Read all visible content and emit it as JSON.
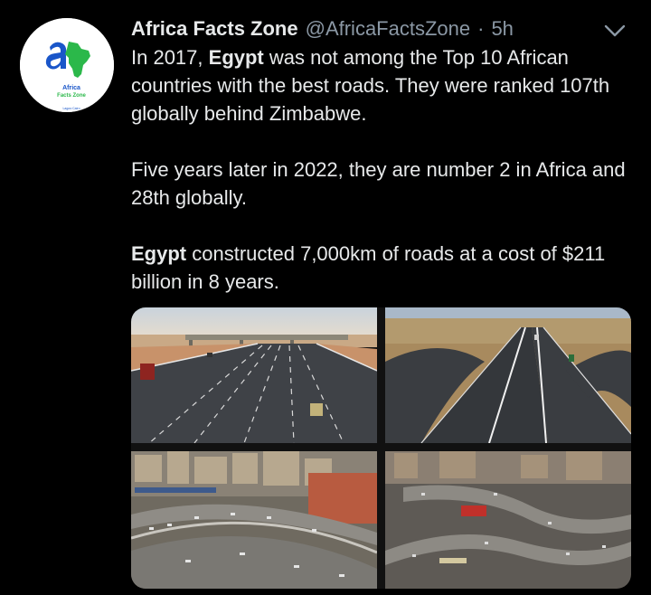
{
  "tweet": {
    "author_name": "Africa Facts Zone",
    "handle": "@AfricaFactsZone",
    "separator": "·",
    "time": "5h",
    "avatar_text": {
      "line1": "Africa",
      "line2": "Facts Zone",
      "line3": "Lagos·Cairo"
    },
    "body": {
      "p1_before": "In 2017, ",
      "p1_bold": "Egypt",
      "p1_after": " was not among the Top 10 African countries with the best roads. They were ranked 107th globally behind Zimbabwe.",
      "p2": "Five years later in 2022, they are number 2 in Africa and 28th globally.",
      "p3_bold": "Egypt",
      "p3_after": " constructed 7,000km of roads at a cost of $211 billion in 8 years."
    },
    "media": [
      {
        "name": "straight-multilane-highway-photo"
      },
      {
        "name": "curved-highway-interchange-photo"
      },
      {
        "name": "city-flyover-traffic-photo"
      },
      {
        "name": "urban-interchange-traffic-photo"
      }
    ]
  },
  "colors": {
    "background": "#000000",
    "text": "#e7e9ea",
    "muted": "#8b98a5",
    "logo_blue": "#1a56c9",
    "logo_green": "#2bb84a"
  }
}
